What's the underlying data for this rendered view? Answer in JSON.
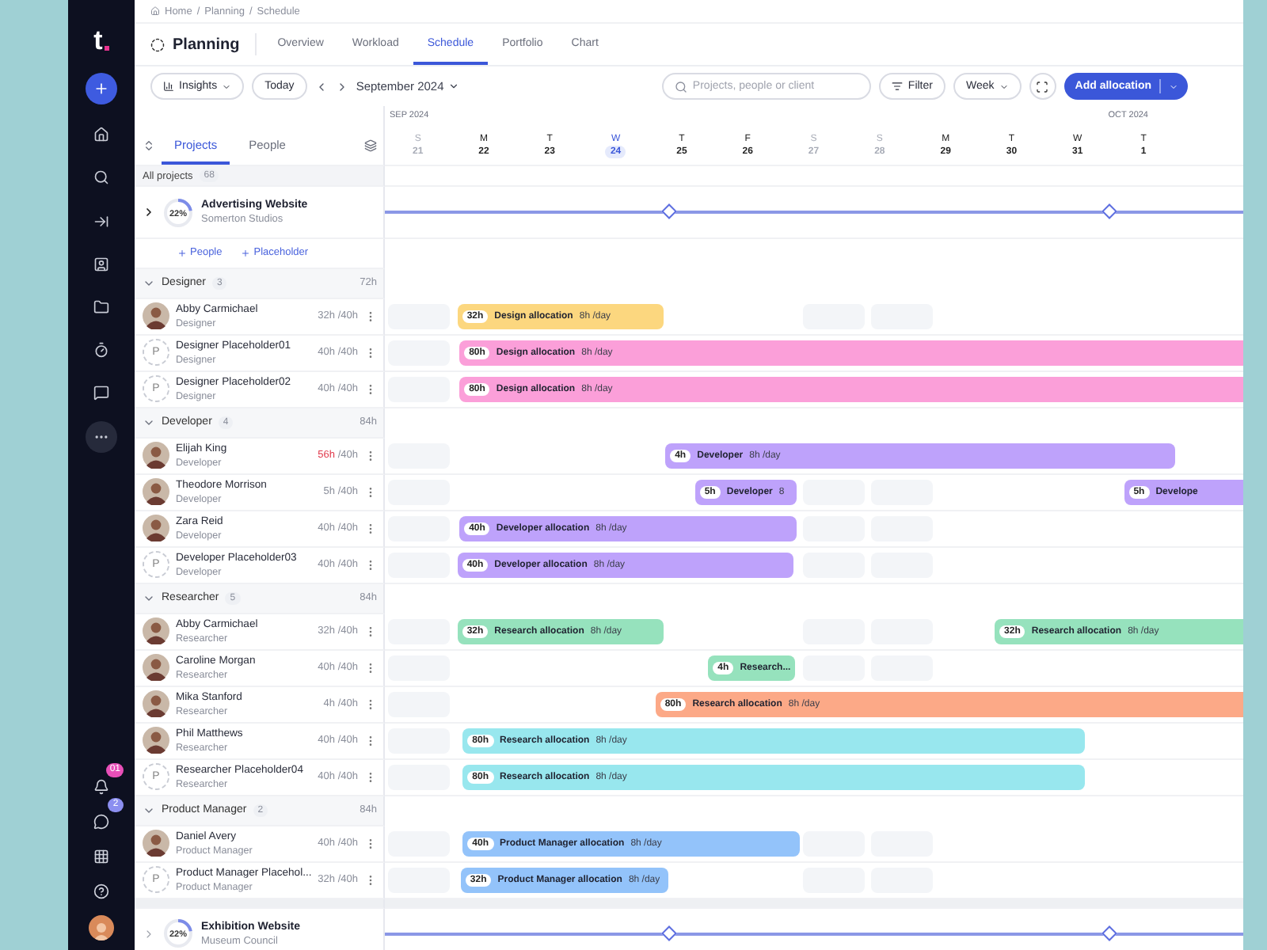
{
  "sidebar": {
    "logo": "t",
    "items": [
      {
        "kind": "add",
        "selected": false
      },
      {
        "kind": "home",
        "selected": false
      },
      {
        "kind": "search",
        "selected": false
      },
      {
        "kind": "collapse",
        "selected": false
      },
      {
        "kind": "people",
        "selected": false
      },
      {
        "kind": "folder",
        "selected": false
      },
      {
        "kind": "timer",
        "selected": false
      },
      {
        "kind": "feedback",
        "selected": false
      },
      {
        "kind": "more",
        "selected": true
      }
    ],
    "bottom": [
      {
        "kind": "bell",
        "badge": "01",
        "color": "#e84fb8"
      },
      {
        "kind": "chat",
        "badge": "2",
        "color": "#8c8ff0"
      },
      {
        "kind": "apps"
      },
      {
        "kind": "help"
      },
      {
        "kind": "avatar"
      }
    ]
  },
  "breadcrumb": [
    "Home",
    "Planning",
    "Schedule"
  ],
  "breadcrumb_separator": "/",
  "header": {
    "title": "Planning",
    "tabs": [
      {
        "label": "Overview",
        "selected": false
      },
      {
        "label": "Workload",
        "selected": false
      },
      {
        "label": "Schedule",
        "selected": true
      },
      {
        "label": "Portfolio",
        "selected": false
      },
      {
        "label": "Chart",
        "selected": false
      }
    ]
  },
  "toolbar": {
    "insights": "Insights",
    "today": "Today",
    "period": "September 2024",
    "search": {
      "placeholder": "Projects, people or client"
    },
    "filter": "Filter",
    "view": "Week",
    "add": "Add allocation"
  },
  "panel": {
    "tabs": [
      {
        "label": "Projects",
        "selected": true
      },
      {
        "label": "People",
        "selected": false
      }
    ],
    "all_label": "All projects",
    "all_count": "68"
  },
  "months": [
    "SEP 2024",
    "OCT 2024"
  ],
  "days": [
    {
      "weekday": "S",
      "date": "21",
      "weekend": true,
      "today": false
    },
    {
      "weekday": "M",
      "date": "22",
      "weekend": false,
      "today": false
    },
    {
      "weekday": "T",
      "date": "23",
      "weekend": false,
      "today": false
    },
    {
      "weekday": "W",
      "date": "24",
      "weekend": false,
      "today": true
    },
    {
      "weekday": "T",
      "date": "25",
      "weekend": false,
      "today": false
    },
    {
      "weekday": "F",
      "date": "26",
      "weekend": false,
      "today": false
    },
    {
      "weekday": "S",
      "date": "27",
      "weekend": true,
      "today": false
    },
    {
      "weekday": "S",
      "date": "28",
      "weekend": true,
      "today": false
    },
    {
      "weekday": "M",
      "date": "29",
      "weekend": false,
      "today": false
    },
    {
      "weekday": "T",
      "date": "30",
      "weekend": false,
      "today": false
    },
    {
      "weekday": "W",
      "date": "31",
      "weekend": false,
      "today": false
    },
    {
      "weekday": "T",
      "date": "1",
      "weekend": false,
      "today": false
    }
  ],
  "projects": [
    {
      "name": "Advertising Website",
      "client": "Somerton Studios",
      "progress": "22%",
      "level": 0.22,
      "expanded": true,
      "add_links": [
        "People",
        "Placeholder"
      ],
      "groups": [
        {
          "name": "Designer",
          "count": "3",
          "hours": "72h",
          "expanded": true,
          "people": [
            {
              "name": "Abby Carmichael",
              "role": "Designer",
              "kind": "photo",
              "booked": "32h",
              "capacity": "/40h",
              "over": false,
              "allocations": [
                {
                  "hours": "32h",
                  "label": "Design allocation",
                  "rate": "8h /day",
                  "color": "#fcd77f"
                }
              ]
            },
            {
              "name": "Designer Placeholder01",
              "role": "Designer",
              "kind": "placeholder",
              "initial": "P",
              "booked": "40h",
              "capacity": "/40h",
              "over": false,
              "allocations": [
                {
                  "hours": "80h",
                  "label": "Design allocation",
                  "rate": "8h /day",
                  "color": "#fb9fd9"
                }
              ]
            },
            {
              "name": "Designer Placeholder02",
              "role": "Designer",
              "kind": "placeholder",
              "initial": "P",
              "booked": "40h",
              "capacity": "/40h",
              "over": false,
              "allocations": [
                {
                  "hours": "80h",
                  "label": "Design allocation",
                  "rate": "8h /day",
                  "color": "#fb9fd9"
                }
              ]
            }
          ]
        },
        {
          "name": "Developer",
          "count": "4",
          "hours": "84h",
          "expanded": true,
          "people": [
            {
              "name": "Elijah King",
              "role": "Developer",
              "kind": "photo",
              "booked": "56h",
              "capacity": "/40h",
              "over": true,
              "allocations": [
                {
                  "hours": "4h",
                  "label": "Developer",
                  "rate": "8h /day",
                  "color": "#bea2fb"
                }
              ]
            },
            {
              "name": "Theodore Morrison",
              "role": "Developer",
              "kind": "photo",
              "booked": "5h",
              "capacity": "/40h",
              "over": false,
              "allocations": [
                {
                  "hours": "5h",
                  "label": "Developer",
                  "rate": "8",
                  "color": "#bea2fb"
                },
                {
                  "hours": "5h",
                  "label": "Develope",
                  "color": "#bea2fb"
                }
              ]
            },
            {
              "name": "Zara Reid",
              "role": "Developer",
              "kind": "photo",
              "booked": "40h",
              "capacity": "/40h",
              "over": false,
              "allocations": [
                {
                  "hours": "40h",
                  "label": "Developer allocation",
                  "rate": "8h /day",
                  "color": "#bea2fb"
                }
              ]
            },
            {
              "name": "Developer Placeholder03",
              "role": "Developer",
              "kind": "placeholder",
              "initial": "P",
              "booked": "40h",
              "capacity": "/40h",
              "over": false,
              "allocations": [
                {
                  "hours": "40h",
                  "label": "Developer allocation",
                  "rate": "8h /day",
                  "color": "#bea2fb"
                }
              ]
            }
          ]
        },
        {
          "name": "Researcher",
          "count": "5",
          "hours": "84h",
          "expanded": true,
          "people": [
            {
              "name": "Abby Carmichael",
              "role": "Researcher",
              "kind": "photo",
              "booked": "32h",
              "capacity": "/40h",
              "over": false,
              "allocations": [
                {
                  "hours": "32h",
                  "label": "Research allocation",
                  "rate": "8h /day",
                  "color": "#96e2bd"
                },
                {
                  "hours": "32h",
                  "label": "Research allocation",
                  "rate": "8h /day",
                  "color": "#96e2bd"
                }
              ]
            },
            {
              "name": "Caroline Morgan",
              "role": "Researcher",
              "kind": "photo",
              "booked": "40h",
              "capacity": "/40h",
              "over": false,
              "allocations": [
                {
                  "hours": "4h",
                  "label": "Research...",
                  "color": "#96e2bd"
                }
              ]
            },
            {
              "name": "Mika Stanford",
              "role": "Researcher",
              "kind": "photo",
              "booked": "4h",
              "capacity": "/40h",
              "over": false,
              "allocations": [
                {
                  "hours": "80h",
                  "label": "Research allocation",
                  "rate": "8h /day",
                  "color": "#fca987"
                }
              ]
            },
            {
              "name": "Phil Matthews",
              "role": "Researcher",
              "kind": "photo",
              "booked": "40h",
              "capacity": "/40h",
              "over": false,
              "allocations": [
                {
                  "hours": "80h",
                  "label": "Research allocation",
                  "rate": "8h /day",
                  "color": "#98e7ee"
                }
              ]
            },
            {
              "name": "Researcher Placeholder04",
              "role": "Researcher",
              "kind": "placeholder",
              "initial": "P",
              "booked": "40h",
              "capacity": "/40h",
              "over": false,
              "allocations": [
                {
                  "hours": "80h",
                  "label": "Research allocation",
                  "rate": "8h /day",
                  "color": "#98e7ee"
                }
              ]
            }
          ]
        },
        {
          "name": "Product Manager",
          "count": "2",
          "hours": "84h",
          "expanded": true,
          "people": [
            {
              "name": "Daniel Avery",
              "role": "Product Manager",
              "kind": "photo",
              "booked": "40h",
              "capacity": "/40h",
              "over": false,
              "allocations": [
                {
                  "hours": "40h",
                  "label": "Product Manager allocation",
                  "rate": "8h /day",
                  "color": "#93c3fa"
                }
              ]
            },
            {
              "name": "Product Manager Placehol...",
              "role": "Product Manager",
              "kind": "placeholder",
              "initial": "P",
              "booked": "32h",
              "capacity": "/40h",
              "over": false,
              "allocations": [
                {
                  "hours": "32h",
                  "label": "Product Manager allocation",
                  "rate": "8h /day",
                  "color": "#93c3fa"
                }
              ]
            }
          ]
        }
      ]
    },
    {
      "name": "Exhibition Website",
      "client": "Museum Council",
      "progress": "22%",
      "level": 0.22,
      "expanded": false
    }
  ]
}
